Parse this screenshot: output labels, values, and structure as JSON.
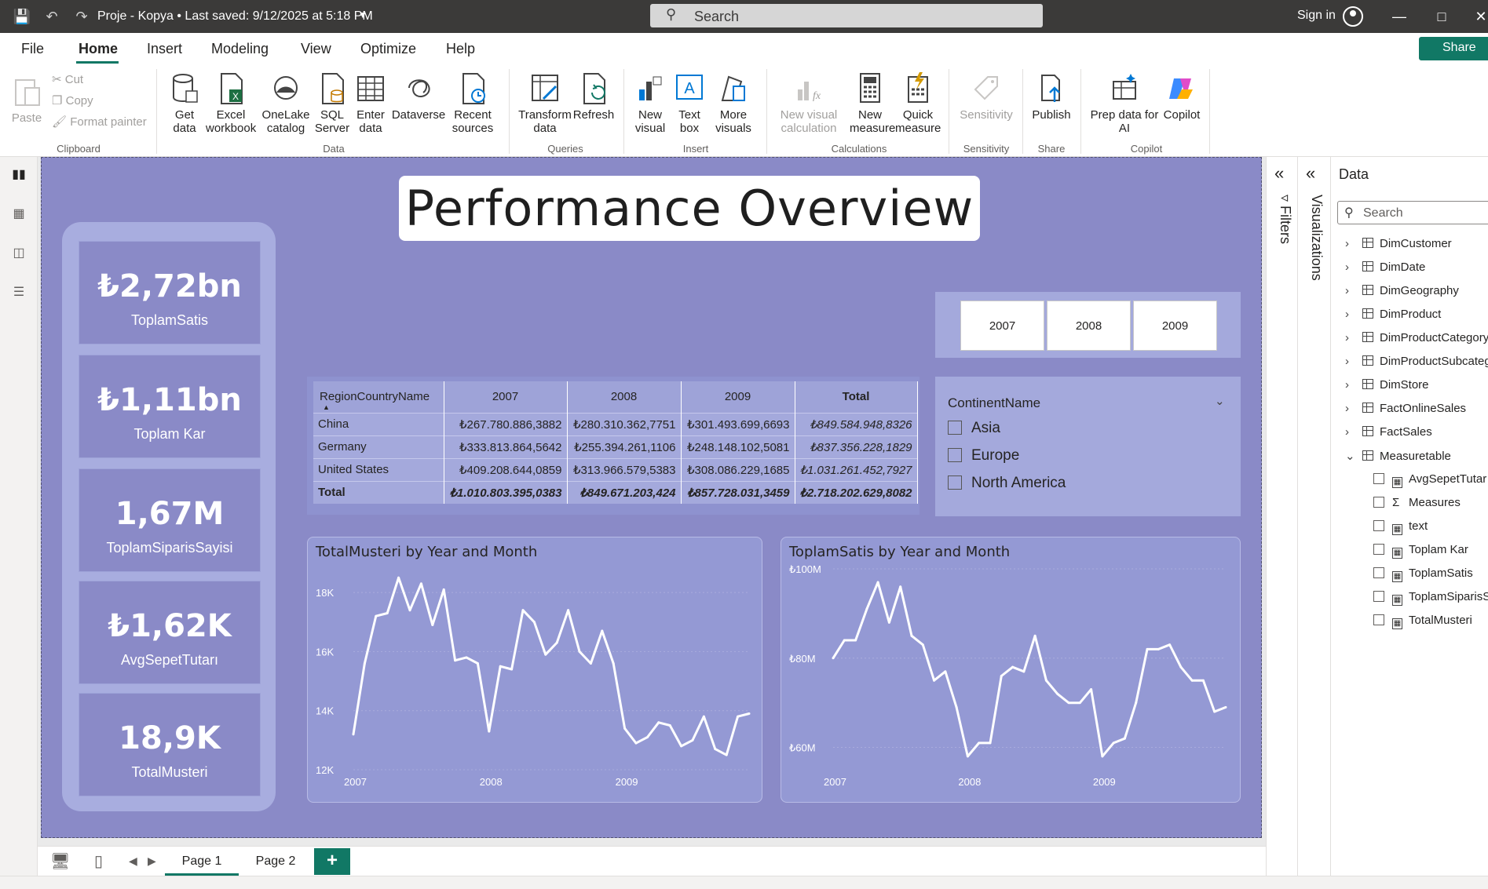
{
  "titlebar": {
    "doc_title": "Proje - Kopya • Last saved: 9/12/2025 at 5:18 PM",
    "search_label": "Search",
    "sign_in": "Sign in"
  },
  "menu": {
    "tabs": [
      "File",
      "Home",
      "Insert",
      "Modeling",
      "View",
      "Optimize",
      "Help"
    ],
    "active": "Home",
    "share": "Share"
  },
  "ribbon": {
    "clipboard": {
      "paste": "Paste",
      "cut": "Cut",
      "copy": "Copy",
      "format_painter": "Format painter",
      "group": "Clipboard"
    },
    "data": {
      "get_data": "Get data",
      "excel": "Excel workbook",
      "onelake": "OneLake catalog",
      "sql": "SQL Server",
      "enter": "Enter data",
      "dataverse": "Dataverse",
      "recent": "Recent sources",
      "group": "Data"
    },
    "queries": {
      "transform": "Transform data",
      "refresh": "Refresh",
      "group": "Queries"
    },
    "insert": {
      "new_visual": "New visual",
      "text_box": "Text box",
      "more_visuals": "More visuals",
      "group": "Insert"
    },
    "calculations": {
      "new_visual_calc": "New visual calculation",
      "new_measure": "New measure",
      "quick_measure": "Quick measure",
      "group": "Calculations"
    },
    "sensitivity": {
      "label": "Sensitivity",
      "group": "Sensitivity"
    },
    "share": {
      "publish": "Publish",
      "group": "Share"
    },
    "copilot": {
      "prep": "Prep data for AI",
      "copilot": "Copilot",
      "group": "Copilot"
    }
  },
  "report": {
    "title": "Performance Overview",
    "kpis": [
      {
        "value": "₺2,72bn",
        "label": "ToplamSatis"
      },
      {
        "value": "₺1,11bn",
        "label": "Toplam Kar"
      },
      {
        "value": "1,67M",
        "label": "ToplamSiparisSayisi"
      },
      {
        "value": "₺1,62K",
        "label": "AvgSepetTutarı"
      },
      {
        "value": "18,9K",
        "label": "TotalMusteri"
      }
    ],
    "year_slicer": [
      "2007",
      "2008",
      "2009"
    ],
    "matrix": {
      "headers": [
        "RegionCountryName",
        "2007",
        "2008",
        "2009",
        "Total"
      ],
      "rows": [
        [
          "China",
          "₺267.780.886,3882",
          "₺280.310.362,7751",
          "₺301.493.699,6693",
          "₺849.584.948,8326"
        ],
        [
          "Germany",
          "₺333.813.864,5642",
          "₺255.394.261,1106",
          "₺248.148.102,5081",
          "₺837.356.228,1829"
        ],
        [
          "United States",
          "₺409.208.644,0859",
          "₺313.966.579,5383",
          "₺308.086.229,1685",
          "₺1.031.261.452,7927"
        ]
      ],
      "total": [
        "Total",
        "₺1.010.803.395,0383",
        "₺849.671.203,424",
        "₺857.728.031,3459",
        "₺2.718.202.629,8082"
      ]
    },
    "continent_slicer": {
      "title": "ContinentName",
      "options": [
        "Asia",
        "Europe",
        "North America"
      ]
    }
  },
  "chart_data": [
    {
      "type": "line",
      "title": "TotalMusteri by Year and Month",
      "y_tick_labels": [
        "12K",
        "14K",
        "16K",
        "18K"
      ],
      "x_tick_labels": [
        "2007",
        "2008",
        "2009"
      ],
      "ylim": [
        12000,
        18800
      ],
      "grid": true,
      "x": [
        "2007-01",
        "2007-02",
        "2007-03",
        "2007-04",
        "2007-05",
        "2007-06",
        "2007-07",
        "2007-08",
        "2007-09",
        "2007-10",
        "2007-11",
        "2007-12",
        "2008-01",
        "2008-02",
        "2008-03",
        "2008-04",
        "2008-05",
        "2008-06",
        "2008-07",
        "2008-08",
        "2008-09",
        "2008-10",
        "2008-11",
        "2008-12",
        "2009-01",
        "2009-02",
        "2009-03",
        "2009-04",
        "2009-05",
        "2009-06",
        "2009-07",
        "2009-08",
        "2009-09",
        "2009-10",
        "2009-11",
        "2009-12"
      ],
      "values": [
        13200,
        15600,
        17200,
        17300,
        18500,
        17400,
        18300,
        16900,
        18100,
        15700,
        15800,
        15600,
        13300,
        15500,
        15400,
        17400,
        17000,
        15900,
        16300,
        17400,
        16000,
        15600,
        16700,
        15600,
        13400,
        12900,
        13100,
        13600,
        13500,
        12800,
        13000,
        13800,
        12700,
        12500,
        13800,
        13900
      ]
    },
    {
      "type": "line",
      "title": "ToplamSatis by Year and Month",
      "y_tick_labels": [
        "₺60M",
        "₺80M",
        "₺100M"
      ],
      "x_tick_labels": [
        "2007",
        "2008",
        "2009"
      ],
      "ylim": [
        55000000,
        100000000
      ],
      "grid": true,
      "x": [
        "2007-01",
        "2007-02",
        "2007-03",
        "2007-04",
        "2007-05",
        "2007-06",
        "2007-07",
        "2007-08",
        "2007-09",
        "2007-10",
        "2007-11",
        "2007-12",
        "2008-01",
        "2008-02",
        "2008-03",
        "2008-04",
        "2008-05",
        "2008-06",
        "2008-07",
        "2008-08",
        "2008-09",
        "2008-10",
        "2008-11",
        "2008-12",
        "2009-01",
        "2009-02",
        "2009-03",
        "2009-04",
        "2009-05",
        "2009-06",
        "2009-07",
        "2009-08",
        "2009-09",
        "2009-10",
        "2009-11",
        "2009-12"
      ],
      "values": [
        80000000,
        84000000,
        84000000,
        91000000,
        97000000,
        88000000,
        96000000,
        85000000,
        83000000,
        75000000,
        77000000,
        69000000,
        58000000,
        61000000,
        61000000,
        76000000,
        78000000,
        77000000,
        85000000,
        75000000,
        72000000,
        70000000,
        70000000,
        73000000,
        58000000,
        61000000,
        62000000,
        70000000,
        82000000,
        82000000,
        83000000,
        78000000,
        75000000,
        75000000,
        68000000,
        69000000
      ]
    }
  ],
  "panes": {
    "filters": "Filters",
    "visualizations": "Visualizations",
    "data": {
      "title": "Data",
      "search_placeholder": "Search",
      "tables": [
        "DimCustomer",
        "DimDate",
        "DimGeography",
        "DimProduct",
        "DimProductCategory",
        "DimProductSubcateg",
        "DimStore",
        "FactOnlineSales",
        "FactSales"
      ],
      "measure_table": "Measuretable",
      "fields": [
        "AvgSepetTutar",
        "Measures",
        "text",
        "Toplam Kar",
        "ToplamSatis",
        "ToplamSiparisS",
        "TotalMusteri"
      ]
    }
  },
  "pages": {
    "tabs": [
      "Page 1",
      "Page 2"
    ],
    "add": "+"
  },
  "colors": {
    "accent": "#117865",
    "canvas": "#8a8ac7",
    "panel": "#a4a9dc"
  }
}
